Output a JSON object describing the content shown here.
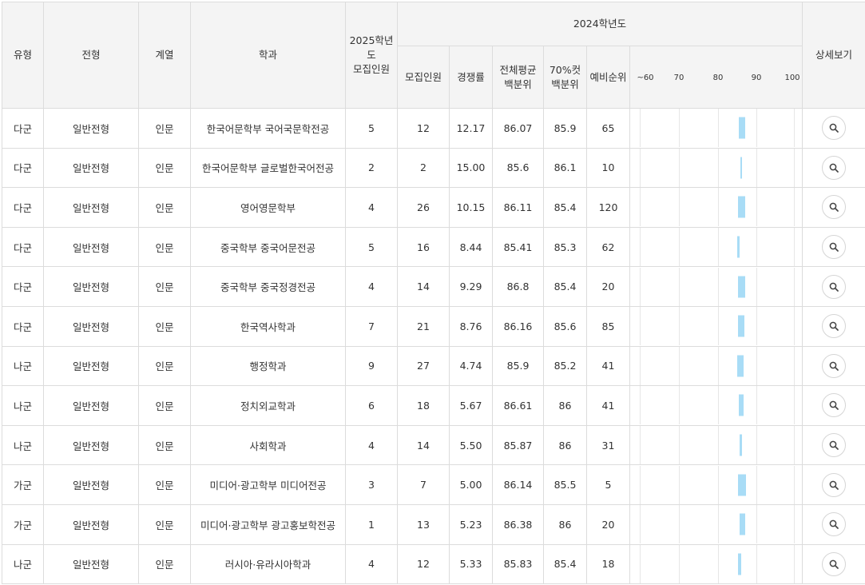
{
  "header": {
    "col_type": "유형",
    "col_admission": "전형",
    "col_field": "계열",
    "col_dept": "학과",
    "col_2025_quota": "2025학년도\n모집인원",
    "col_2024_group": "2024학년도",
    "col_2024_quota": "모집인원",
    "col_competition": "경쟁률",
    "col_avg_percentile": "전체평균\n백분위",
    "col_70cut_percentile": "70%컷\n백분위",
    "col_waitlist": "예비순위",
    "col_detail": "상세보기",
    "scale_ticks": [
      "~60",
      "70",
      "80",
      "90",
      "100"
    ]
  },
  "rows": [
    {
      "type": "다군",
      "admission": "일반전형",
      "field": "인문",
      "dept": "한국어문학부 국어국문학전공",
      "quota_2025": "5",
      "quota_2024": "12",
      "competition": "12.17",
      "avg": "86.07",
      "cut70": "85.9",
      "waitlist": "65"
    },
    {
      "type": "다군",
      "admission": "일반전형",
      "field": "인문",
      "dept": "한국어문학부 글로벌한국어전공",
      "quota_2025": "2",
      "quota_2024": "2",
      "competition": "15.00",
      "avg": "85.6",
      "cut70": "86.1",
      "waitlist": "10"
    },
    {
      "type": "다군",
      "admission": "일반전형",
      "field": "인문",
      "dept": "영어영문학부",
      "quota_2025": "4",
      "quota_2024": "26",
      "competition": "10.15",
      "avg": "86.11",
      "cut70": "85.4",
      "waitlist": "120"
    },
    {
      "type": "다군",
      "admission": "일반전형",
      "field": "인문",
      "dept": "중국학부 중국어문전공",
      "quota_2025": "5",
      "quota_2024": "16",
      "competition": "8.44",
      "avg": "85.41",
      "cut70": "85.3",
      "waitlist": "62"
    },
    {
      "type": "다군",
      "admission": "일반전형",
      "field": "인문",
      "dept": "중국학부 중국정경전공",
      "quota_2025": "4",
      "quota_2024": "14",
      "competition": "9.29",
      "avg": "86.8",
      "cut70": "85.4",
      "waitlist": "20"
    },
    {
      "type": "다군",
      "admission": "일반전형",
      "field": "인문",
      "dept": "한국역사학과",
      "quota_2025": "7",
      "quota_2024": "21",
      "competition": "8.76",
      "avg": "86.16",
      "cut70": "85.6",
      "waitlist": "85"
    },
    {
      "type": "나군",
      "admission": "일반전형",
      "field": "인문",
      "dept": "행정학과",
      "quota_2025": "9",
      "quota_2024": "27",
      "competition": "4.74",
      "avg": "85.9",
      "cut70": "85.2",
      "waitlist": "41"
    },
    {
      "type": "나군",
      "admission": "일반전형",
      "field": "인문",
      "dept": "정치외교학과",
      "quota_2025": "6",
      "quota_2024": "18",
      "competition": "5.67",
      "avg": "86.61",
      "cut70": "86",
      "waitlist": "41"
    },
    {
      "type": "나군",
      "admission": "일반전형",
      "field": "인문",
      "dept": "사회학과",
      "quota_2025": "4",
      "quota_2024": "14",
      "competition": "5.50",
      "avg": "85.87",
      "cut70": "86",
      "waitlist": "31"
    },
    {
      "type": "가군",
      "admission": "일반전형",
      "field": "인문",
      "dept": "미디어·광고학부 미디어전공",
      "quota_2025": "3",
      "quota_2024": "7",
      "competition": "5.00",
      "avg": "86.14",
      "cut70": "85.5",
      "waitlist": "5"
    },
    {
      "type": "가군",
      "admission": "일반전형",
      "field": "인문",
      "dept": "미디어·광고학부 광고홍보학전공",
      "quota_2025": "1",
      "quota_2024": "13",
      "competition": "5.23",
      "avg": "86.38",
      "cut70": "86",
      "waitlist": "20"
    },
    {
      "type": "나군",
      "admission": "일반전형",
      "field": "인문",
      "dept": "러시아·유라시아학과",
      "quota_2025": "4",
      "quota_2024": "12",
      "competition": "5.33",
      "avg": "85.83",
      "cut70": "85.4",
      "waitlist": "18"
    }
  ],
  "bars": [
    {
      "lo": 85.5,
      "hi": 87.0,
      "h": 0.56
    },
    {
      "lo": 85.9,
      "hi": 86.1,
      "h": 0.56
    },
    {
      "lo": 85.3,
      "hi": 87.1,
      "h": 0.56
    },
    {
      "lo": 84.9,
      "hi": 85.7,
      "h": 0.56
    },
    {
      "lo": 85.3,
      "hi": 87.0,
      "h": 0.56
    },
    {
      "lo": 85.3,
      "hi": 86.8,
      "h": 0.56
    },
    {
      "lo": 85.0,
      "hi": 86.7,
      "h": 0.56
    },
    {
      "lo": 85.5,
      "hi": 86.6,
      "h": 0.56
    },
    {
      "lo": 85.6,
      "hi": 86.3,
      "h": 0.56
    },
    {
      "lo": 85.2,
      "hi": 87.2,
      "h": 0.56
    },
    {
      "lo": 85.6,
      "hi": 87.1,
      "h": 0.56
    },
    {
      "lo": 85.2,
      "hi": 86.1,
      "h": 0.56
    }
  ],
  "colors": {
    "bar": "#a8dcf6",
    "header_bg": "#f4f4f4",
    "border": "#dcdcdc"
  },
  "icons": {
    "detail": "magnifier-icon"
  }
}
